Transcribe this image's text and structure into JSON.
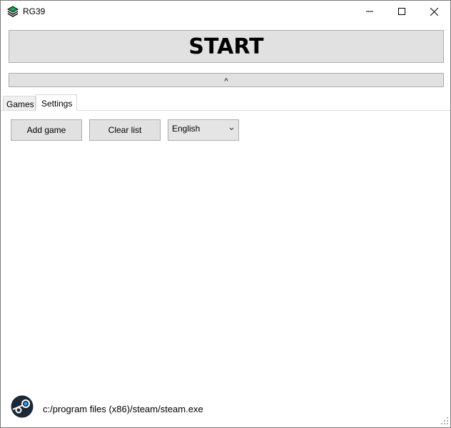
{
  "window": {
    "title": "RG39",
    "controls": {
      "minimize_icon": "minimize-icon",
      "maximize_icon": "maximize-icon",
      "close_icon": "close-icon"
    }
  },
  "main": {
    "start_label": "START",
    "collapse_label": "^"
  },
  "tabs": [
    {
      "label": "Games",
      "active": false
    },
    {
      "label": "Settings",
      "active": true
    }
  ],
  "settings": {
    "add_game_label": "Add game",
    "clear_list_label": "Clear list",
    "language": {
      "selected": "English"
    },
    "steam": {
      "icon": "steam-icon",
      "path": "c:/program files (x86)/steam/steam.exe"
    }
  },
  "colors": {
    "button_face": "#e1e1e1",
    "button_border": "#adadad",
    "window_border": "#7a7a7a",
    "steam_dark": "#1b2838",
    "steam_blue": "#1a9fff"
  }
}
